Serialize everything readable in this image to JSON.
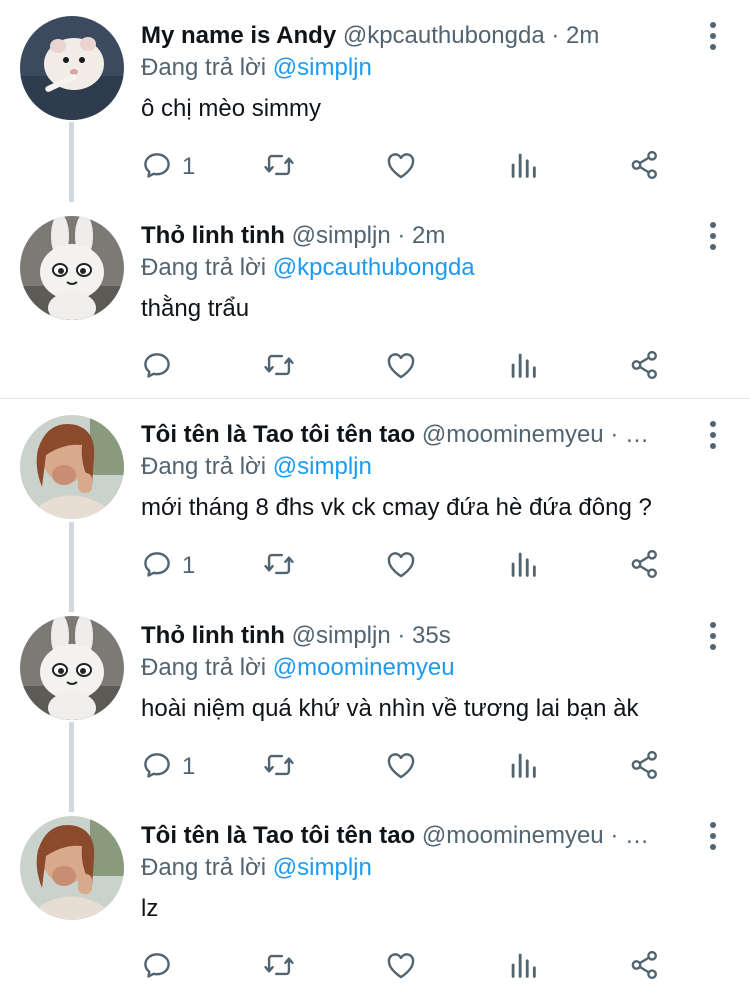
{
  "tweets": [
    {
      "name": "My name is Andy",
      "handle": "@kpcauthubongda",
      "dot": "·",
      "time": "2m",
      "reply_prefix": "Đang trả lời",
      "reply_to": "@simpljn",
      "text": "ô chị mèo simmy",
      "reply_count": "1",
      "avatar": "hamster"
    },
    {
      "name": "Thỏ linh tinh",
      "handle": "@simpljn",
      "dot": "·",
      "time": "2m",
      "reply_prefix": "Đang trả lời",
      "reply_to": "@kpcauthubongda",
      "text": "thằng trẩu",
      "reply_count": "",
      "avatar": "bunny"
    },
    {
      "name": "Tôi tên là Tao tôi tên tao",
      "handle": "@moominemyeu",
      "dot": "· …",
      "time": "",
      "reply_prefix": "Đang trả lời",
      "reply_to": "@simpljn",
      "text": "mới tháng 8 đhs vk ck cmay đứa hè đứa đông ?",
      "reply_count": "1",
      "avatar": "girl"
    },
    {
      "name": "Thỏ linh tinh",
      "handle": "@simpljn",
      "dot": "·",
      "time": "35s",
      "reply_prefix": "Đang trả lời",
      "reply_to": "@moominemyeu",
      "text": "hoài niệm quá khứ và nhìn về tương lai bạn àk",
      "reply_count": "1",
      "avatar": "bunny"
    },
    {
      "name": "Tôi tên là Tao tôi tên tao",
      "handle": "@moominemyeu",
      "dot": "· …",
      "time": "",
      "reply_prefix": "Đang trả lời",
      "reply_to": "@simpljn",
      "text": "lz",
      "reply_count": "",
      "avatar": "girl"
    }
  ],
  "icons": {
    "reply": "reply-icon",
    "retweet": "retweet-icon",
    "like": "like-icon",
    "views": "views-icon",
    "share": "share-icon",
    "more": "more-icon"
  },
  "colors": {
    "name": "#0f1419",
    "secondary": "#536471",
    "mention": "#1d9bf0",
    "thread_line": "#cfd9de"
  }
}
